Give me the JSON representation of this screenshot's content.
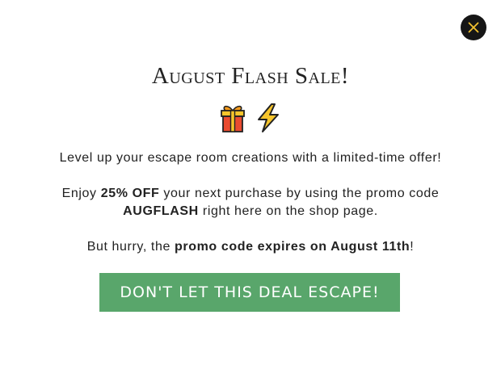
{
  "modal": {
    "title": "August Flash Sale!",
    "icons": [
      "gift-icon",
      "lightning-icon"
    ],
    "close_icon": "close-icon",
    "paragraph1": "Level up your escape room creations with a limited-time offer!",
    "paragraph2": {
      "text1": "Enjoy ",
      "bold1": "25% OFF",
      "text2": " your next purchase by using the promo code ",
      "bold2": "AUGFLASH",
      "text3": " right here on the shop page."
    },
    "paragraph3": {
      "text1": "But hurry, the ",
      "bold1": "promo code expires on August 11th",
      "text2": "!"
    },
    "cta_label": "DON'T LET THIS DEAL ESCAPE!"
  },
  "colors": {
    "cta_background": "#59a66b",
    "close_background": "#161616",
    "close_icon": "#f2c230",
    "text": "#222222"
  }
}
